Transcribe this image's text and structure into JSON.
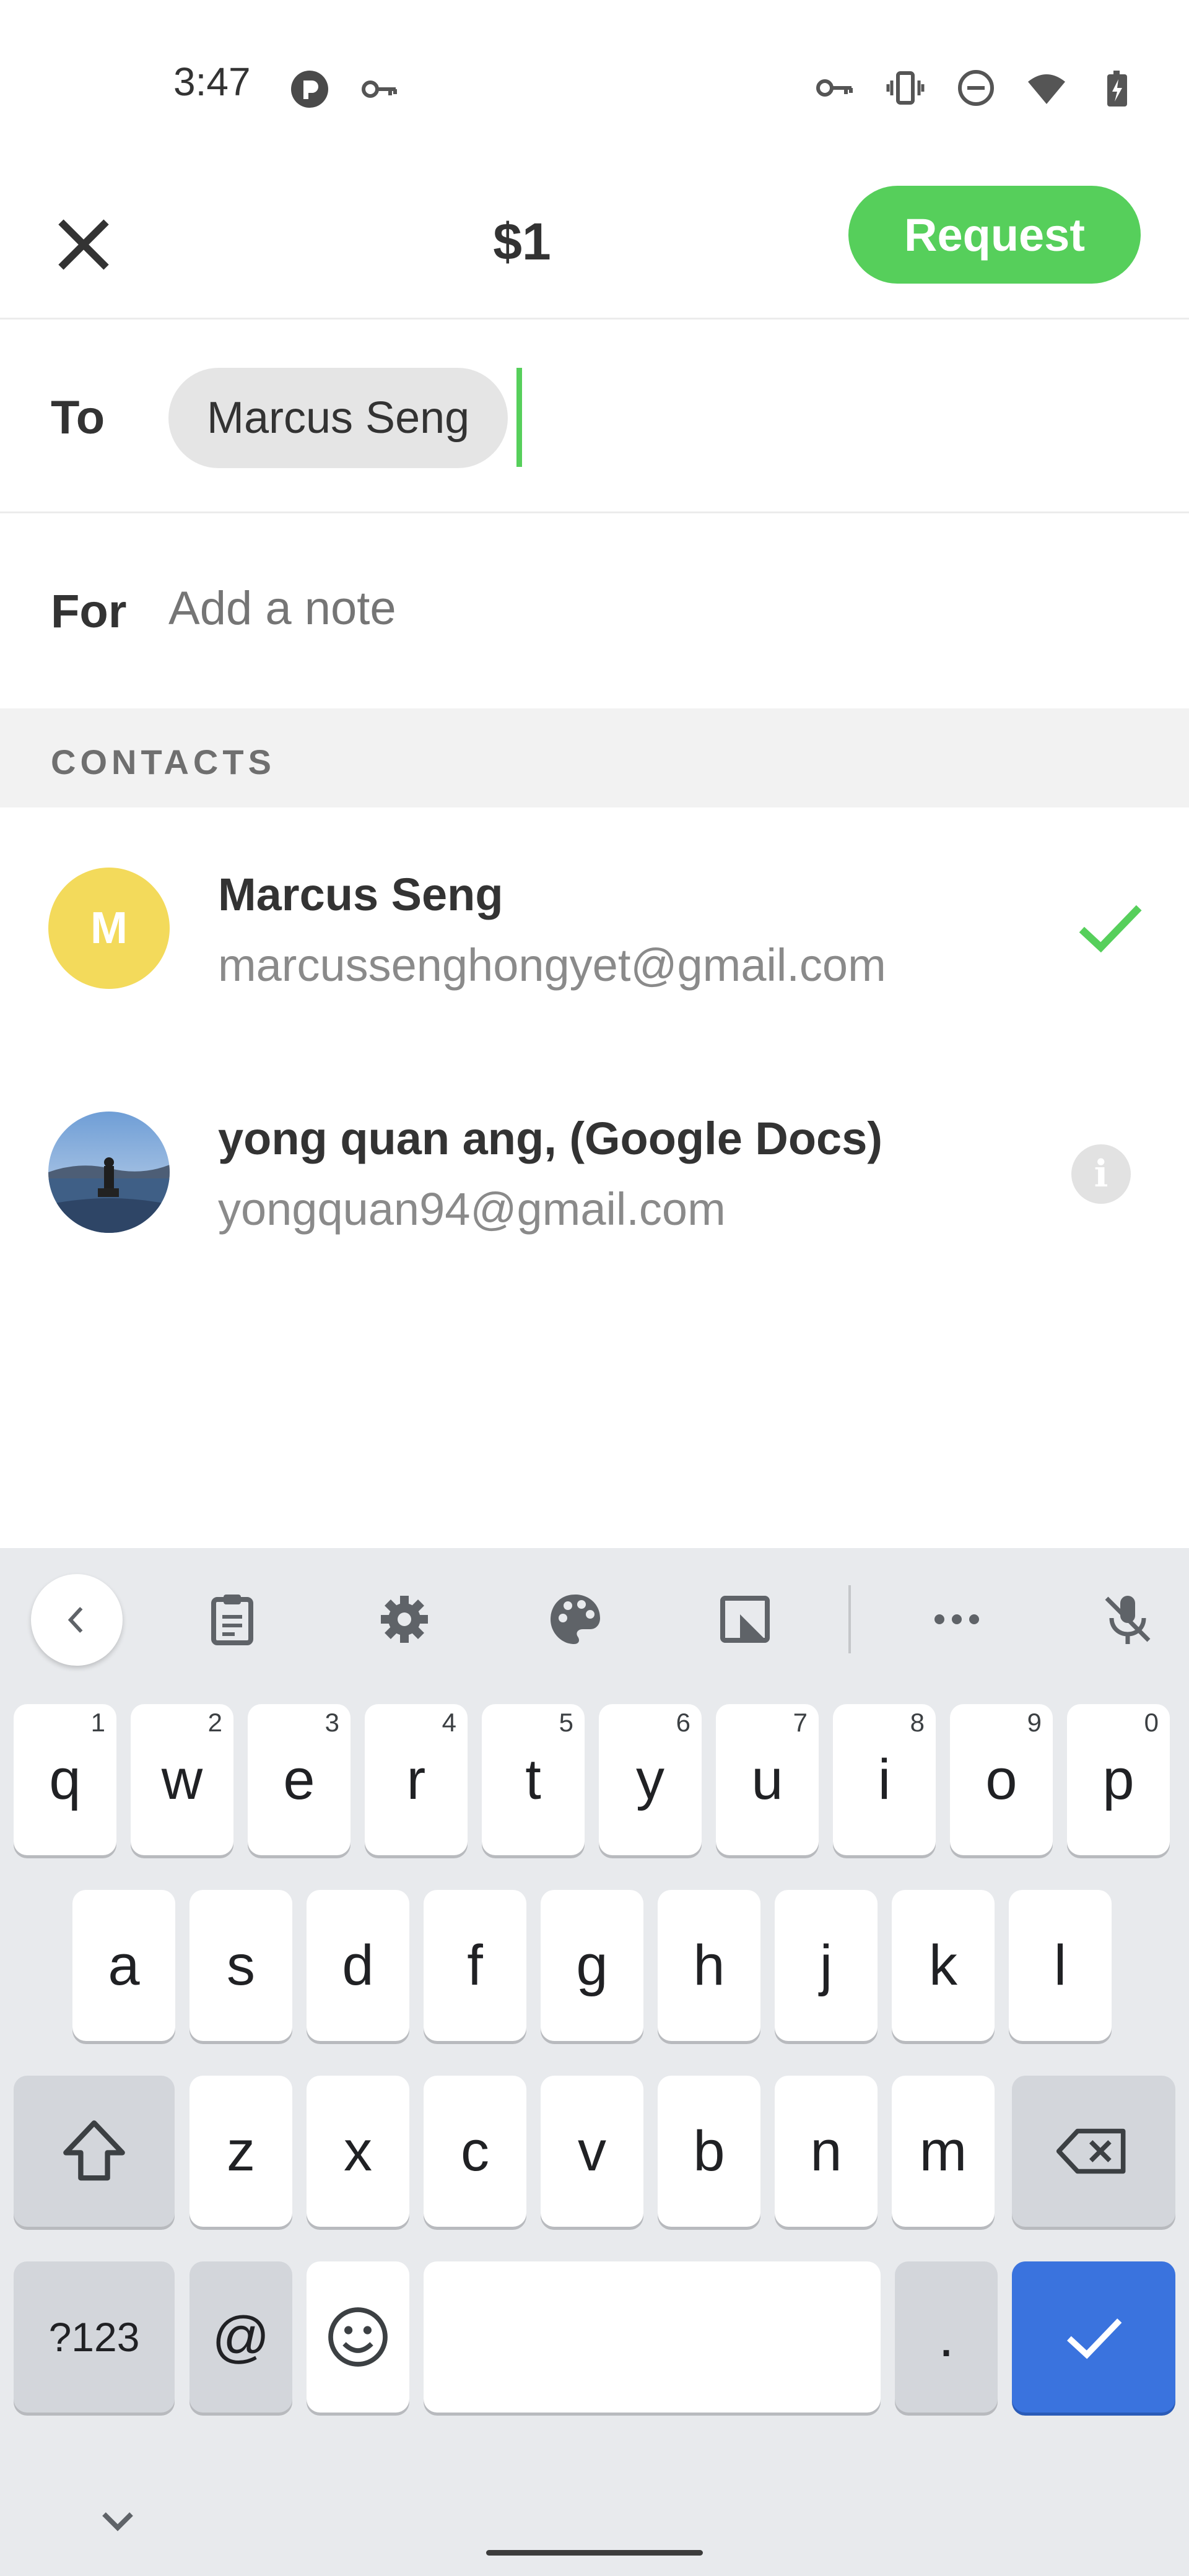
{
  "status_bar": {
    "time": "3:47",
    "left_icons": [
      "app-notification-icon",
      "vpn-key-icon"
    ],
    "right_icons": [
      "vpn-key-icon",
      "vibrate-icon",
      "do-not-disturb-icon",
      "wifi-icon",
      "battery-charging-icon"
    ]
  },
  "header": {
    "amount": "$1",
    "request_label": "Request",
    "close_icon": "close-icon"
  },
  "form": {
    "to_label": "To",
    "recipient_chip": "Marcus Seng",
    "for_label": "For",
    "note_placeholder": "Add a note",
    "note_value": ""
  },
  "contacts": {
    "section_title": "CONTACTS",
    "items": [
      {
        "initial": "M",
        "name": "Marcus Seng",
        "email": "marcussenghongyet@gmail.com",
        "selected": true,
        "avatar_color": "#f3da5b",
        "trailing_icon": "check-icon"
      },
      {
        "initial": "",
        "name": "yong quan ang, (Google Docs)",
        "email": "yongquan94@gmail.com",
        "selected": false,
        "trailing_icon": "info-icon"
      }
    ]
  },
  "keyboard": {
    "toolbar_icons": [
      "back-chevron-icon",
      "clipboard-icon",
      "settings-icon",
      "theme-palette-icon",
      "floating-keyboard-icon",
      "more-icon",
      "mic-off-icon"
    ],
    "row1": [
      {
        "key": "q",
        "hint": "1"
      },
      {
        "key": "w",
        "hint": "2"
      },
      {
        "key": "e",
        "hint": "3"
      },
      {
        "key": "r",
        "hint": "4"
      },
      {
        "key": "t",
        "hint": "5"
      },
      {
        "key": "y",
        "hint": "6"
      },
      {
        "key": "u",
        "hint": "7"
      },
      {
        "key": "i",
        "hint": "8"
      },
      {
        "key": "o",
        "hint": "9"
      },
      {
        "key": "p",
        "hint": "0"
      }
    ],
    "row2": [
      "a",
      "s",
      "d",
      "f",
      "g",
      "h",
      "j",
      "k",
      "l"
    ],
    "row3": [
      "z",
      "x",
      "c",
      "v",
      "b",
      "n",
      "m"
    ],
    "symbols_label": "?123",
    "at_label": "@",
    "period_label": ".",
    "space_label": "",
    "accent_color": "#3a73de"
  },
  "colors": {
    "brand_green": "#56cf5b",
    "chip_bg": "#e5e5e5",
    "section_bg": "#f2f2f2"
  }
}
